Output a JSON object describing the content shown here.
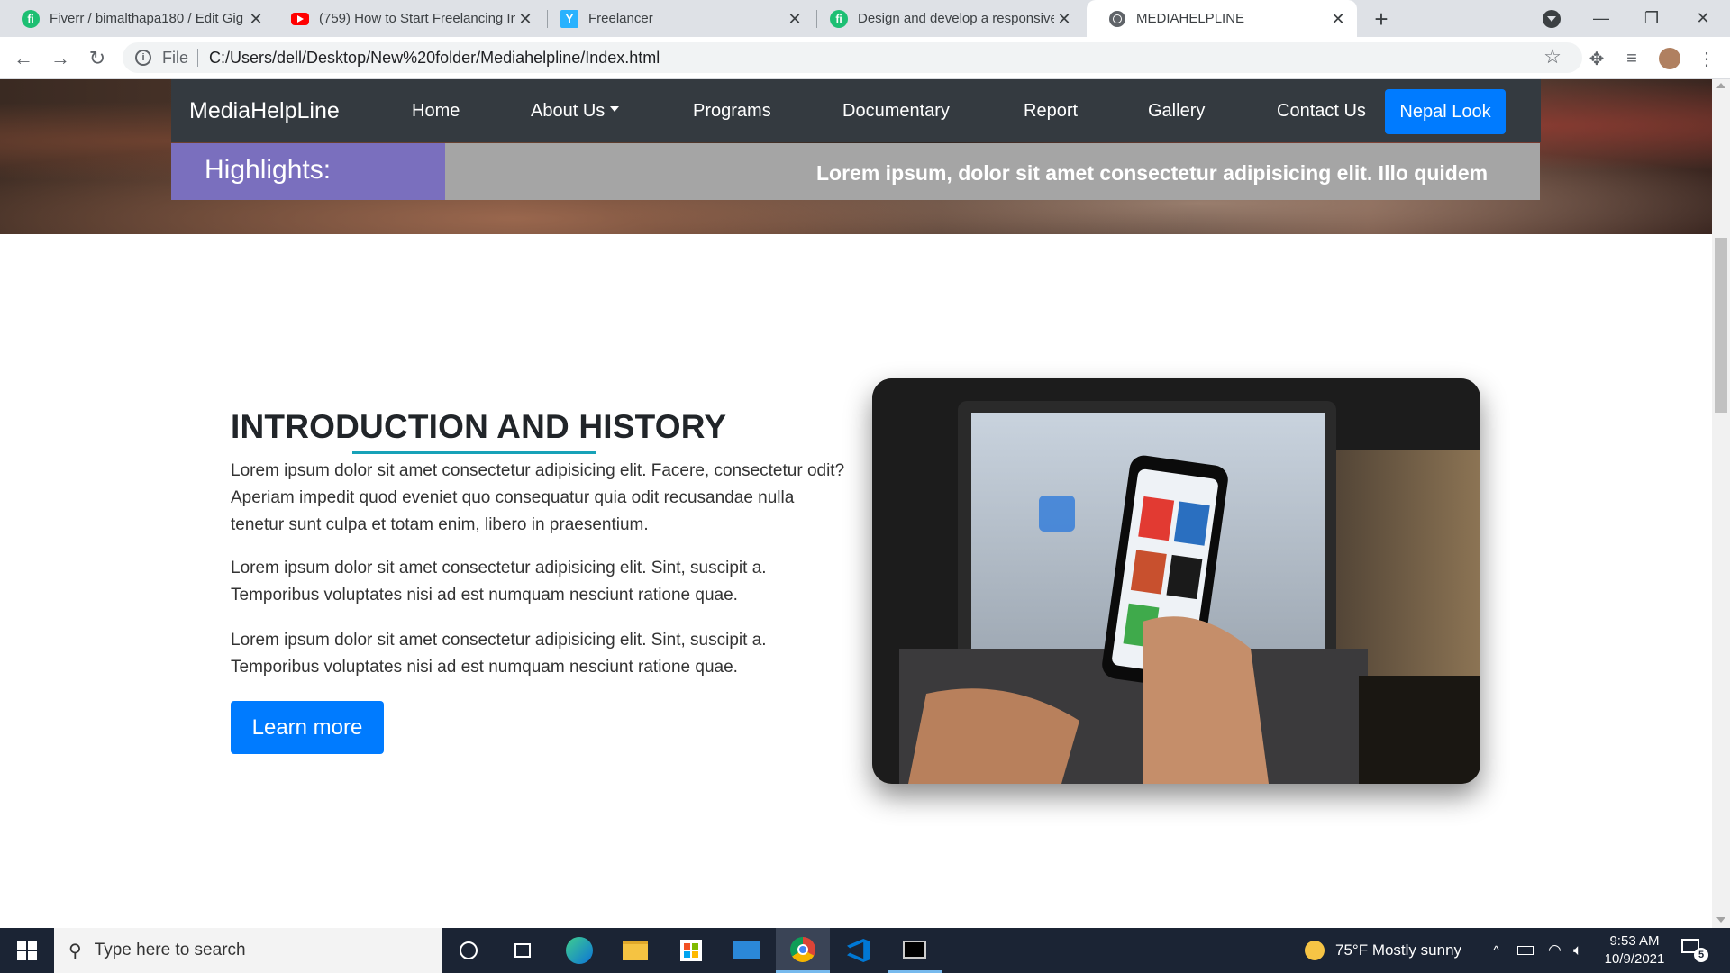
{
  "browser": {
    "tabs": [
      {
        "title": "Fiverr / bimalthapa180 / Edit Gig",
        "favicon": "fiverr-icon"
      },
      {
        "title": "(759) How to Start Freelancing In",
        "favicon": "youtube-icon"
      },
      {
        "title": "Freelancer",
        "favicon": "freelancer-icon"
      },
      {
        "title": "Design and develop a responsive",
        "favicon": "fiverr-icon"
      },
      {
        "title": "MEDIAHELPLINE",
        "favicon": "globe-icon",
        "active": true
      }
    ],
    "address": {
      "scheme_label": "File",
      "url": "C:/Users/dell/Desktop/New%20folder/Mediahelpline/Index.html"
    }
  },
  "site": {
    "brand": "MediaHelpLine",
    "nav": {
      "home": "Home",
      "about": "About Us",
      "programs": "Programs",
      "documentary": "Documentary",
      "report": "Report",
      "gallery": "Gallery",
      "contact": "Contact Us",
      "cta": "Nepal Look"
    },
    "highlights": {
      "label": "Highlights:",
      "ticker": "Lorem ipsum, dolor sit amet consectetur adipisicing elit. Illo quidem"
    },
    "intro": {
      "title": "INTRODUCTION AND HISTORY",
      "paragraphs": [
        "Lorem ipsum dolor sit amet consectetur adipisicing elit. Facere, consectetur odit? Aperiam impedit quod eveniet quo consequatur quia odit recusandae nulla tenetur sunt culpa et totam enim, libero in praesentium.",
        "Lorem ipsum dolor sit amet consectetur adipisicing elit. Sint, suscipit a. Temporibus voluptates nisi ad est numquam nesciunt ratione quae.",
        "Lorem ipsum dolor sit amet consectetur adipisicing elit. Sint, suscipit a. Temporibus voluptates nisi ad est numquam nesciunt ratione quae."
      ],
      "button": "Learn more"
    },
    "colors": {
      "navbar": "#343a40",
      "primary": "#007bff",
      "highlight_label": "#7a6fbe",
      "underline": "#17a2b8"
    }
  },
  "taskbar": {
    "search_placeholder": "Type here to search",
    "weather": "75°F  Mostly sunny",
    "time": "9:53 AM",
    "date": "10/9/2021",
    "notifications": "5"
  }
}
